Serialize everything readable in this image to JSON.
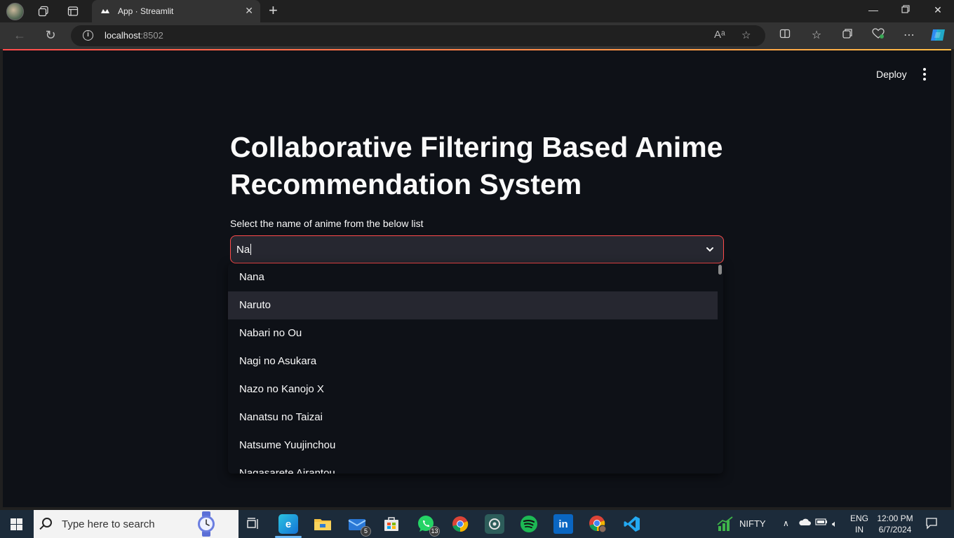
{
  "browser": {
    "tab_title": "App · Streamlit",
    "url_host": "localhost",
    "url_port": ":8502"
  },
  "streamlit": {
    "deploy_label": "Deploy",
    "title": "Collaborative Filtering Based Anime Recommendation System",
    "select_label": "Select the name of anime from the below list",
    "select_value": "Na",
    "options": [
      "Nana",
      "Naruto",
      "Nabari no Ou",
      "Nagi no Asukara",
      "Nazo no Kanojo X",
      "Nanatsu no Taizai",
      "Natsume Yuujinchou",
      "Nagasarete Airantou"
    ],
    "highlighted_option": "Naruto"
  },
  "taskbar": {
    "search_placeholder": "Type here to search",
    "mail_badge": "5",
    "whatsapp_badge": "13",
    "stock_label": "NIFTY",
    "lang_line1": "ENG",
    "lang_line2": "IN",
    "time": "12:00 PM",
    "date": "6/7/2024"
  },
  "colors": {
    "page_bg": "#0e1117",
    "accent_red": "#ff4b4b",
    "select_bg": "#262730"
  }
}
